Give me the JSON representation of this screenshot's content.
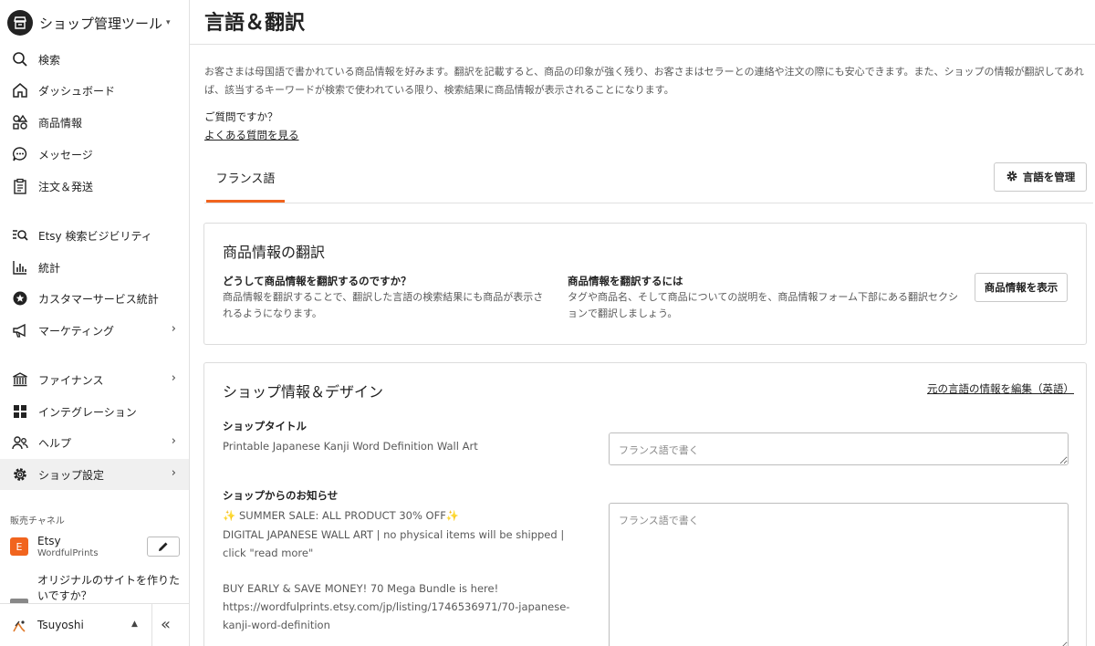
{
  "app": {
    "title": "ショップ管理ツール",
    "caret": "▾"
  },
  "sidebar": {
    "items": [
      {
        "label": "検索",
        "icon": "search-icon"
      },
      {
        "label": "ダッシュボード",
        "icon": "home-icon"
      },
      {
        "label": "商品情報",
        "icon": "shapes-icon"
      },
      {
        "label": "メッセージ",
        "icon": "chat-icon"
      },
      {
        "label": "注文＆発送",
        "icon": "clipboard-icon"
      },
      {
        "label": "Etsy 検索ビジビリティ",
        "icon": "search-list-icon"
      },
      {
        "label": "統計",
        "icon": "bar-chart-icon"
      },
      {
        "label": "カスタマーサービス統計",
        "icon": "star-badge-icon"
      },
      {
        "label": "マーケティング",
        "icon": "megaphone-icon"
      },
      {
        "label": "ファイナンス",
        "icon": "bank-icon"
      },
      {
        "label": "インテグレーション",
        "icon": "grid-icon"
      },
      {
        "label": "ヘルプ",
        "icon": "people-icon"
      },
      {
        "label": "ショップ設定",
        "icon": "gear-icon"
      }
    ],
    "chevron": "›",
    "section_label": "販売チャネル",
    "channel": {
      "badge": "E",
      "name": "Etsy",
      "sub": "WordfulPrints"
    },
    "promo": "オリジナルのサイトを作りたいですか？",
    "user": {
      "name": "Tsuyoshi",
      "caret": "▲",
      "collapse": "«"
    }
  },
  "main": {
    "title": "言語＆翻訳",
    "intro": "お客さまは母国語で書かれている商品情報を好みます。翻訳を記載すると、商品の印象が強く残り、お客さまはセラーとの連絡や注文の際にも安心できます。また、ショップの情報が翻訳してあれば、該当するキーワードが検索で使われている限り、検索結果に商品情報が表示されることになります。",
    "faq_question": "ご質問ですか？",
    "faq_link": "よくある質問を見る",
    "tab_label": "フランス語",
    "manage_label": "言語を管理",
    "listing_card": {
      "title": "商品情報の翻訳",
      "why_head": "どうして商品情報を翻訳するのですか？",
      "why_body": "商品情報を翻訳することで、翻訳した言語の検索結果にも商品が表示されるようになります。",
      "how_head": "商品情報を翻訳するには",
      "how_body": "タグや商品名、そして商品についての説明を、商品情報フォーム下部にある翻訳セクションで翻訳しましょう。",
      "button": "商品情報を表示"
    },
    "shop_card": {
      "title": "ショップ情報＆デザイン",
      "edit_link": "元の言語の情報を編集（英語）",
      "shop_title_label": "ショップタイトル",
      "shop_title_value": "Printable Japanese Kanji Word Definition Wall Art",
      "shop_title_placeholder": "フランス語で書く",
      "announce_label": "ショップからのお知らせ",
      "announce_line1": "✨ SUMMER SALE: ALL PRODUCT 30% OFF✨",
      "announce_line2": "DIGITAL JAPANESE WALL ART | no physical items will be shipped | click \"read more\"",
      "announce_line3": "BUY EARLY & SAVE MONEY! 70 Mega Bundle is here!",
      "announce_line4": "https://wordfulprints.etsy.com/jp/listing/1746536971/70-japanese-kanji-word-definition",
      "announce_placeholder": "フランス語で書く"
    }
  },
  "colors": {
    "accent": "#f1641e",
    "text": "#222222",
    "muted": "#595959",
    "border": "#e1e1e1"
  }
}
